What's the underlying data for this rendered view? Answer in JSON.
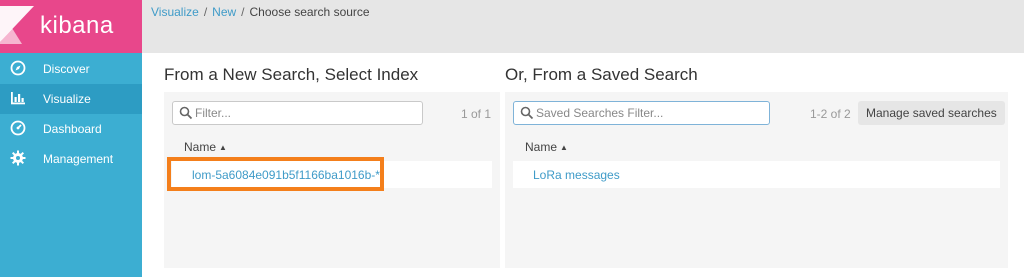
{
  "app": {
    "name": "kibana"
  },
  "colors": {
    "brand": "#e8478b",
    "sidebar": "#3caed2",
    "link": "#3f9bc8",
    "highlight": "#f47f1b"
  },
  "nav": [
    {
      "label": "Discover",
      "icon": "compass-icon",
      "active": false
    },
    {
      "label": "Visualize",
      "icon": "bar-chart-icon",
      "active": true
    },
    {
      "label": "Dashboard",
      "icon": "dashboard-icon",
      "active": false
    },
    {
      "label": "Management",
      "icon": "gear-icon",
      "active": false
    }
  ],
  "breadcrumb": {
    "items": [
      "Visualize",
      "New",
      "Choose search source"
    ],
    "separator": "/"
  },
  "new_search": {
    "title": "From a New Search, Select Index",
    "filter_placeholder": "Filter...",
    "count": "1 of 1",
    "column": "Name",
    "rows": [
      "lom-5a6084e091b5f1166ba1016b-*"
    ]
  },
  "saved_search": {
    "title": "Or, From a Saved Search",
    "filter_placeholder": "Saved Searches Filter...",
    "count": "1-2 of 2",
    "manage_label": "Manage saved searches",
    "column": "Name",
    "rows": [
      "LoRa messages"
    ]
  }
}
